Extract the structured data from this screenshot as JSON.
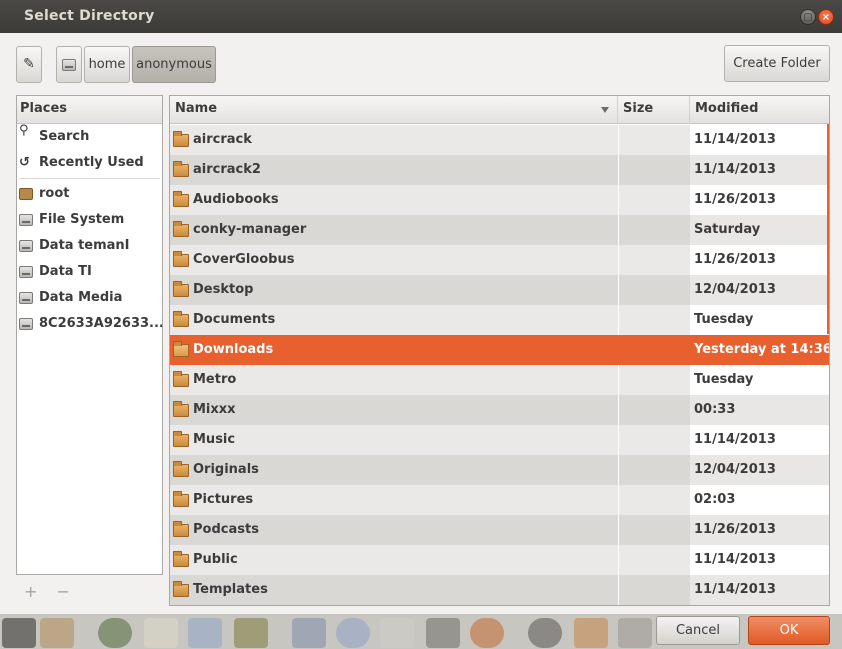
{
  "window": {
    "title": "Select Directory"
  },
  "toolbar": {
    "path_buttons": [
      "home",
      "anonymous"
    ],
    "create_folder_label": "Create Folder"
  },
  "places": {
    "header": "Places",
    "items": [
      {
        "label": "Search",
        "icon": "search-icon"
      },
      {
        "label": "Recently Used",
        "icon": "recent-icon"
      },
      {
        "label": "root",
        "icon": "home-folder-icon"
      },
      {
        "label": "File System",
        "icon": "drive-icon"
      },
      {
        "label": "Data temanI",
        "icon": "drive-icon"
      },
      {
        "label": "Data TI",
        "icon": "drive-icon"
      },
      {
        "label": "Data Media",
        "icon": "drive-icon"
      },
      {
        "label": "8C2633A92633...",
        "icon": "drive-icon"
      }
    ],
    "add_label": "+",
    "remove_label": "−"
  },
  "files": {
    "columns": {
      "name": "Name",
      "size": "Size",
      "modified": "Modified"
    },
    "selected_index": 7,
    "rows": [
      {
        "name": "aircrack",
        "size": "",
        "modified": "11/14/2013"
      },
      {
        "name": "aircrack2",
        "size": "",
        "modified": "11/14/2013"
      },
      {
        "name": "Audiobooks",
        "size": "",
        "modified": "11/26/2013"
      },
      {
        "name": "conky-manager",
        "size": "",
        "modified": "Saturday"
      },
      {
        "name": "CoverGloobus",
        "size": "",
        "modified": "11/26/2013"
      },
      {
        "name": "Desktop",
        "size": "",
        "modified": "12/04/2013"
      },
      {
        "name": "Documents",
        "size": "",
        "modified": "Tuesday"
      },
      {
        "name": "Downloads",
        "size": "",
        "modified": "Yesterday at 14:36"
      },
      {
        "name": "Metro",
        "size": "",
        "modified": "Tuesday"
      },
      {
        "name": "Mixxx",
        "size": "",
        "modified": "00:33"
      },
      {
        "name": "Music",
        "size": "",
        "modified": "11/14/2013"
      },
      {
        "name": "Originals",
        "size": "",
        "modified": "12/04/2013"
      },
      {
        "name": "Pictures",
        "size": "",
        "modified": "02:03"
      },
      {
        "name": "Podcasts",
        "size": "",
        "modified": "11/26/2013"
      },
      {
        "name": "Public",
        "size": "",
        "modified": "11/14/2013"
      },
      {
        "name": "Templates",
        "size": "",
        "modified": "11/14/2013"
      }
    ]
  },
  "buttons": {
    "cancel": "Cancel",
    "ok": "OK"
  },
  "colors": {
    "accent": "#e7602d",
    "titlebar": "#3c3b37",
    "dialog_bg": "#f2f1f0"
  }
}
